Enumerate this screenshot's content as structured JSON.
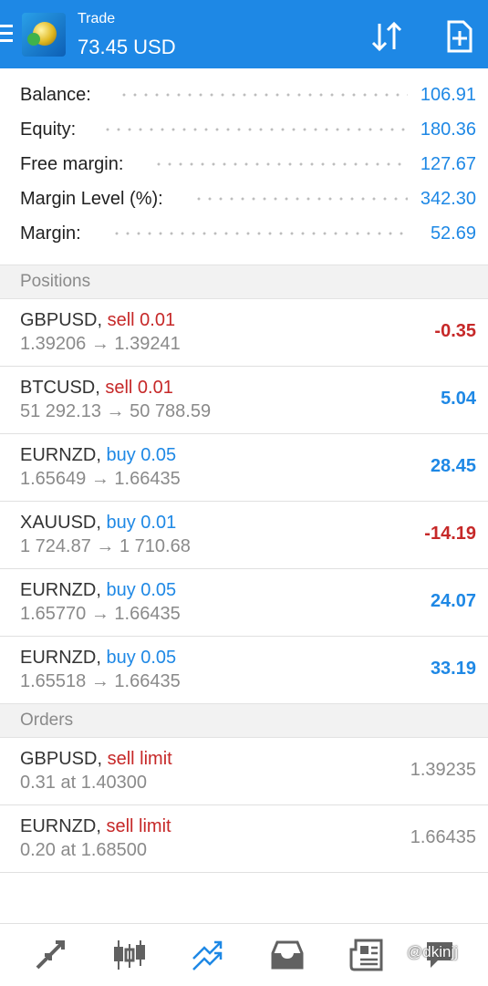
{
  "header": {
    "title": "Trade",
    "subtitle": "73.45 USD"
  },
  "summary": [
    {
      "label": "Balance:",
      "value": "106.91"
    },
    {
      "label": "Equity:",
      "value": "180.36"
    },
    {
      "label": "Free margin:",
      "value": "127.67"
    },
    {
      "label": "Margin Level (%):",
      "value": "342.30"
    },
    {
      "label": "Margin:",
      "value": "52.69"
    }
  ],
  "positions_header": "Positions",
  "positions": [
    {
      "symbol": "GBPUSD,",
      "side": "sell 0.01",
      "prices": "1.39206 → 1.39241",
      "profit": "-0.35"
    },
    {
      "symbol": "BTCUSD,",
      "side": "sell 0.01",
      "prices": "51 292.13 → 50 788.59",
      "profit": "5.04"
    },
    {
      "symbol": "EURNZD,",
      "side": "buy 0.05",
      "prices": "1.65649 → 1.66435",
      "profit": "28.45"
    },
    {
      "symbol": "XAUUSD,",
      "side": "buy 0.01",
      "prices": "1 724.87 → 1 710.68",
      "profit": "-14.19"
    },
    {
      "symbol": "EURNZD,",
      "side": "buy 0.05",
      "prices": "1.65770 → 1.66435",
      "profit": "24.07"
    },
    {
      "symbol": "EURNZD,",
      "side": "buy 0.05",
      "prices": "1.65518 → 1.66435",
      "profit": "33.19"
    }
  ],
  "orders_header": "Orders",
  "orders": [
    {
      "symbol": "GBPUSD,",
      "type": "sell limit",
      "details": "0.31 at 1.40300",
      "price": "1.39235"
    },
    {
      "symbol": "EURNZD,",
      "type": "sell limit",
      "details": "0.20 at 1.68500",
      "price": "1.66435"
    }
  ],
  "bottom_nav": [
    "quotes-icon",
    "chart-icon",
    "trade-icon",
    "history-icon",
    "news-icon"
  ],
  "watermark": "@dkinjj",
  "colors": {
    "accent": "#1e88e5",
    "sell": "#c62828",
    "muted": "#8a8a8a"
  }
}
